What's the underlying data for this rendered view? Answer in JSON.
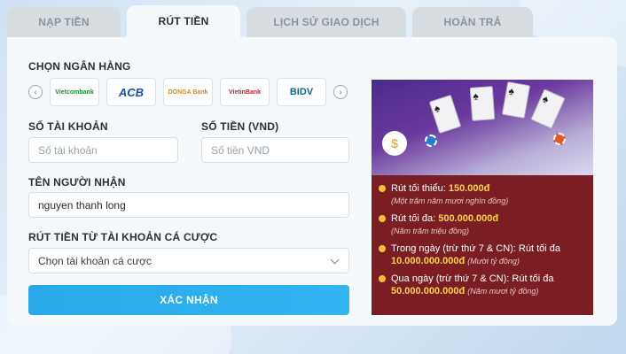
{
  "tabs": [
    {
      "label": "NẠP TIỀN",
      "active": false
    },
    {
      "label": "RÚT TIỀN",
      "active": true
    },
    {
      "label": "LỊCH SỬ GIAO DỊCH",
      "active": false
    },
    {
      "label": "HOÀN TRẢ",
      "active": false
    }
  ],
  "form": {
    "bank_label": "CHỌN NGÂN HÀNG",
    "banks": [
      "Vietcombank",
      "ACB",
      "DONGA Bank",
      "VietinBank",
      "BIDV"
    ],
    "account_label": "SỐ TÀI KHOẢN",
    "account_placeholder": "Số tài khoản",
    "amount_label": "SỐ TIỀN (VND)",
    "amount_placeholder": "Số tiền VND",
    "recipient_label": "TÊN NGƯỜI NHẬN",
    "recipient_value": "nguyen thanh long",
    "source_label": "RÚT TIỀN TỪ TÀI KHOẢN CÁ CƯỢC",
    "source_value": "Chọn tài khoản cá cược",
    "confirm_label": "XÁC NHẬN"
  },
  "promo": {
    "items": [
      {
        "text": "Rút tối thiểu: ",
        "amount": "150.000đ",
        "sub": "(Một trăm năm mươi nghìn đồng)"
      },
      {
        "text": "Rút tối đa: ",
        "amount": "500.000.000đ",
        "sub": "(Năm trăm triệu đồng)"
      },
      {
        "text": "Trong ngày (trừ thứ 7 & CN): Rút tối đa ",
        "amount": "10.000.000.000đ",
        "sub": "(Mười tỷ đồng)"
      },
      {
        "text": "Qua ngày (trừ thứ 7 & CN): Rút tối đa ",
        "amount": "50.000.000.000đ",
        "sub": "(Năm mươi tỷ đồng)"
      }
    ]
  }
}
